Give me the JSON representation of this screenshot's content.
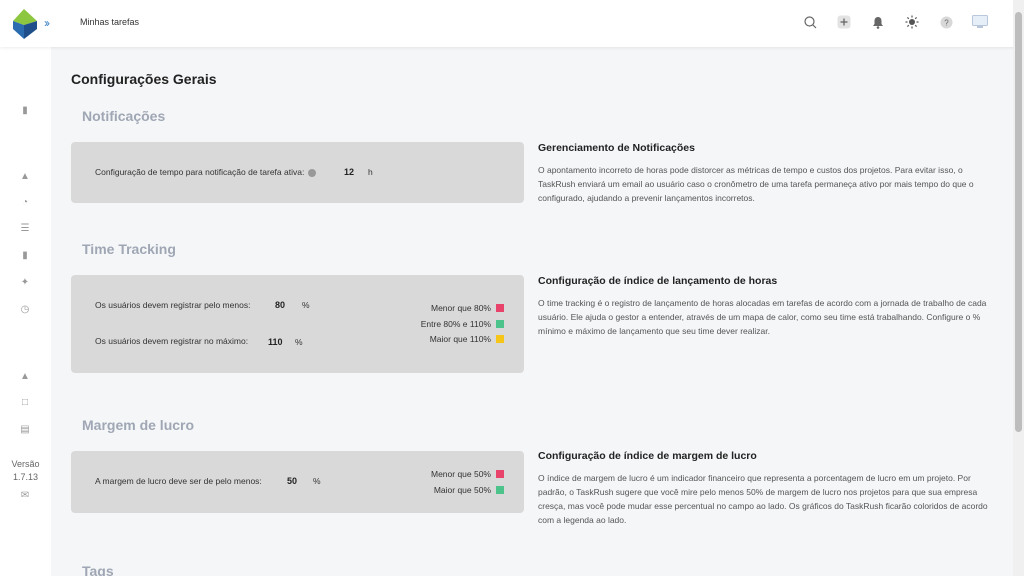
{
  "header": {
    "breadcrumb": "Minhas tarefas",
    "icons": [
      "search-icon",
      "add-icon",
      "bell-icon",
      "sun-icon",
      "help-icon",
      "monitor-icon"
    ]
  },
  "sidebar": {
    "version_label": "Versão",
    "version_number": "1.7.13"
  },
  "page": {
    "title": "Configurações Gerais"
  },
  "sections": {
    "notifications": {
      "title": "Notificações",
      "field_label": "Configuração de tempo para notificação de tarefa ativa:",
      "value": "12",
      "unit": "h",
      "desc_title": "Gerenciamento de Notificações",
      "desc_text": "O apontamento incorreto de horas pode distorcer as métricas de tempo e custos dos projetos. Para evitar isso, o TaskRush enviará um email ao usuário caso o cronômetro de uma tarefa permaneça ativo por mais tempo do que o configurado, ajudando a prevenir lançamentos incorretos."
    },
    "time_tracking": {
      "title": "Time Tracking",
      "min_label": "Os usuários devem registrar pelo menos:",
      "min_value": "80",
      "min_unit": "%",
      "max_label": "Os usuários devem registrar no máximo:",
      "max_value": "110",
      "max_unit": "%",
      "legend": [
        {
          "label": "Menor que 80%",
          "color": "#e8436a"
        },
        {
          "label": "Entre 80% e 110%",
          "color": "#4cc38a"
        },
        {
          "label": "Maior que 110%",
          "color": "#f5c518"
        }
      ],
      "desc_title": "Configuração de índice de lançamento de horas",
      "desc_text": "O time tracking é o registro de lançamento de horas alocadas em tarefas de acordo com a jornada de trabalho de cada usuário. Ele ajuda o gestor a entender, através de um mapa de calor, como seu time está trabalhando. Configure o % mínimo e máximo de lançamento que seu time dever realizar."
    },
    "profit_margin": {
      "title": "Margem de lucro",
      "field_label": "A margem de lucro deve ser de pelo menos:",
      "value": "50",
      "unit": "%",
      "legend": [
        {
          "label": "Menor que 50%",
          "color": "#e8436a"
        },
        {
          "label": "Maior que 50%",
          "color": "#4cc38a"
        }
      ],
      "desc_title": "Configuração de índice de margem de lucro",
      "desc_text": "O índice de margem de lucro é um indicador financeiro que representa a porcentagem de lucro em um projeto. Por padrão, o TaskRush sugere que você mire pelo menos 50% de margem de lucro nos projetos para que sua empresa cresça, mas você pode mudar esse percentual no campo ao lado. Os gráficos do TaskRush ficarão coloridos de acordo com a legenda ao lado."
    },
    "tags": {
      "title": "Tags"
    }
  }
}
